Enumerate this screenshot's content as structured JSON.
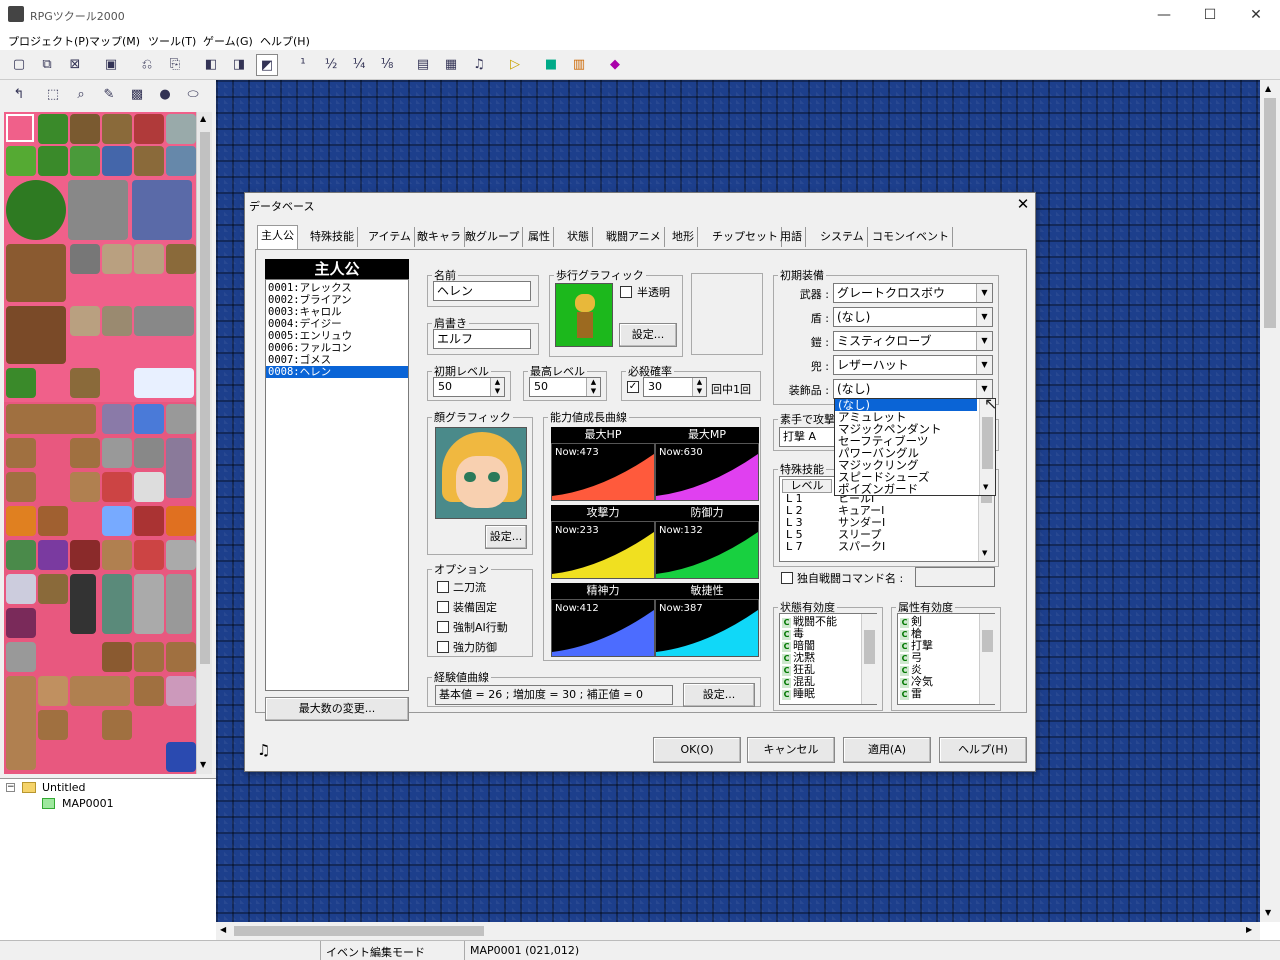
{
  "window": {
    "title": "RPGツクール2000",
    "minimize": "—",
    "maximize": "☐",
    "close": "✕"
  },
  "menu": [
    "プロジェクト(P)",
    "マップ(M)",
    "ツール(T)",
    "ゲーム(G)",
    "ヘルプ(H)"
  ],
  "tree": {
    "root": "Untitled",
    "child": "MAP0001"
  },
  "statusbar": {
    "mode": "イベント編集モード",
    "position": "MAP0001 (021,012)"
  },
  "dialog": {
    "title": "データベース",
    "tabs": [
      "主人公",
      "特殊技能",
      "アイテム",
      "敵キャラ",
      "敵グループ",
      "属性",
      "状態",
      "戦闘アニメ",
      "地形",
      "チップセット",
      "用語",
      "システム",
      "コモンイベント"
    ],
    "list_header": "主人公",
    "heroes": [
      "0001:アレックス",
      "0002:ブライアン",
      "0003:キャロル",
      "0004:デイジー",
      "0005:エンリュウ",
      "0006:ファルコン",
      "0007:ゴメス",
      "0008:ヘレン"
    ],
    "max_button": "最大数の変更...",
    "name_label": "名前",
    "name": "ヘレン",
    "title_label": "肩書き",
    "title_value": "エルフ",
    "walk_label": "歩行グラフィック",
    "translucent": "半透明",
    "set": "設定...",
    "init_level_label": "初期レベル",
    "init_level": "50",
    "max_level_label": "最高レベル",
    "max_level": "50",
    "crit_label": "必殺確率",
    "crit_value": "30",
    "crit_suffix": "回中1回",
    "face_label": "顔グラフィック",
    "stats_label": "能力値成長曲線",
    "stats": [
      {
        "name": "最大HP",
        "now": "Now:473",
        "color": "#ff5a3c"
      },
      {
        "name": "最大MP",
        "now": "Now:630",
        "color": "#e040f0"
      },
      {
        "name": "攻撃力",
        "now": "Now:233",
        "color": "#f0e020"
      },
      {
        "name": "防御力",
        "now": "Now:132",
        "color": "#18d040"
      },
      {
        "name": "精神力",
        "now": "Now:412",
        "color": "#4c6cff"
      },
      {
        "name": "敏捷性",
        "now": "Now:387",
        "color": "#10d8f8"
      }
    ],
    "options_label": "オプション",
    "options": [
      "二刀流",
      "装備固定",
      "強制AI行動",
      "強力防御"
    ],
    "exp_label": "経験値曲線",
    "exp_text": "基本値 = 26 ; 増加度 = 30 ; 補正値 = 0",
    "equip_label": "初期装備",
    "equip": [
      {
        "label": "武器 :",
        "value": "グレートクロスボウ"
      },
      {
        "label": "盾 :",
        "value": "(なし)"
      },
      {
        "label": "鎧 :",
        "value": "ミスティクローブ"
      },
      {
        "label": "兜 :",
        "value": "レザーハット"
      },
      {
        "label": "装飾品 :",
        "value": "(なし)"
      }
    ],
    "dropdown": [
      "(なし)",
      "アミュレット",
      "マジックペンダント",
      "セーフティブーツ",
      "パワーバングル",
      "マジックリング",
      "スピードシューズ",
      "ポイズンガード"
    ],
    "unarmed_label": "素手で攻撃",
    "unarmed_value": "打撃 A",
    "skills_label": "特殊技能",
    "skills_header": "レベル",
    "skills": [
      {
        "lv": "L 1",
        "name": "ヒールⅠ"
      },
      {
        "lv": "L 2",
        "name": "キュアーⅠ"
      },
      {
        "lv": "L 3",
        "name": "サンダーⅠ"
      },
      {
        "lv": "L 5",
        "name": "スリープ"
      },
      {
        "lv": "L 7",
        "name": "スパークⅠ"
      }
    ],
    "custom_cmd": "独自戦闘コマンド名 :",
    "state_label": "状態有効度",
    "states": [
      "戦闘不能",
      "毒",
      "暗闇",
      "沈黙",
      "狂乱",
      "混乱",
      "睡眠"
    ],
    "attr_label": "属性有効度",
    "attrs": [
      "剣",
      "槍",
      "打撃",
      "弓",
      "炎",
      "冷気",
      "雷"
    ],
    "buttons": {
      "ok": "OK(O)",
      "cancel": "キャンセル",
      "apply": "適用(A)",
      "help": "ヘルプ(H)"
    }
  }
}
